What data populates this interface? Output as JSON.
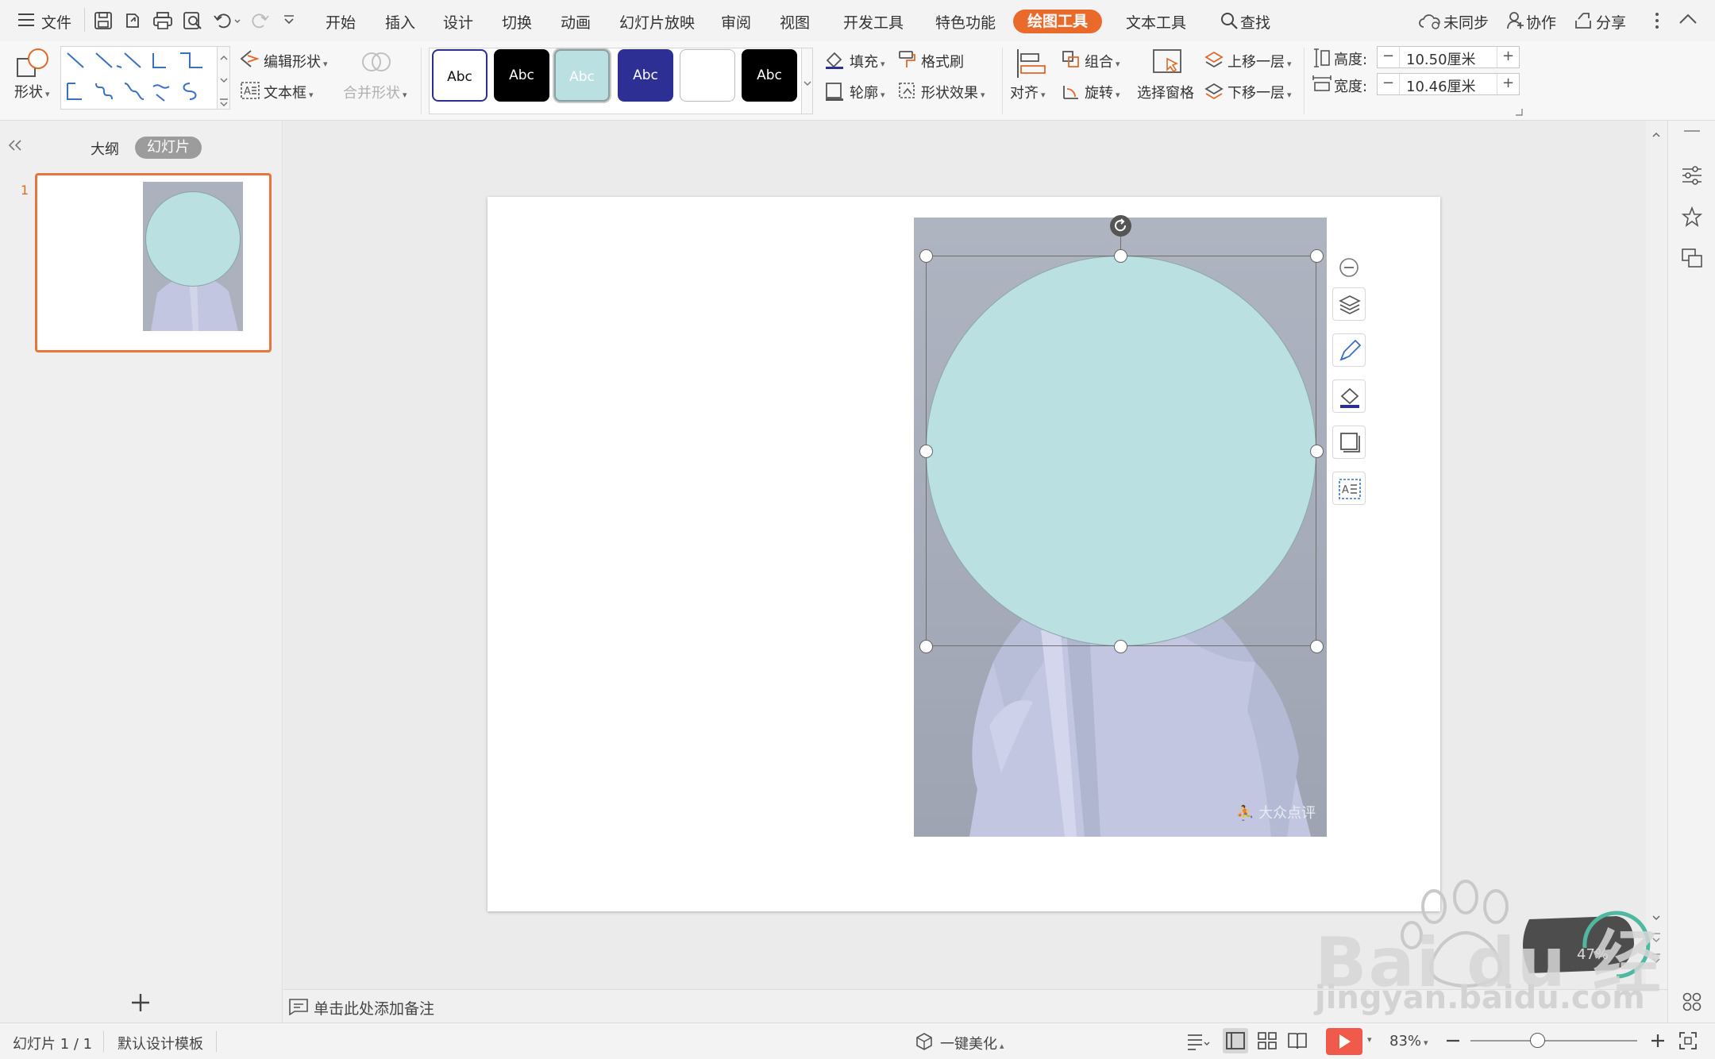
{
  "menu": {
    "file": "文件",
    "tabs": [
      "开始",
      "插入",
      "设计",
      "切换",
      "动画",
      "幻灯片放映",
      "审阅",
      "视图",
      "开发工具",
      "特色功能",
      "绘图工具",
      "文本工具"
    ],
    "search": "查找",
    "sync": "未同步",
    "collab": "协作",
    "share": "分享"
  },
  "ribbon": {
    "shape": "形状",
    "edit_shape": "编辑形状",
    "textbox": "文本框",
    "merge_shape": "合并形状",
    "style_label": "Abc",
    "fill": "填充",
    "format_painter": "格式刷",
    "outline": "轮廓",
    "shape_effect": "形状效果",
    "align": "对齐",
    "group": "组合",
    "rotate": "旋转",
    "selection_pane": "选择窗格",
    "bring_forward": "上移一层",
    "send_backward": "下移一层",
    "height_label": "高度:",
    "height_value": "10.50厘米",
    "width_label": "宽度:",
    "width_value": "10.46厘米"
  },
  "panel": {
    "outline_tab": "大纲",
    "slides_tab": "幻灯片",
    "slide_number": "1"
  },
  "notes": {
    "placeholder": "单击此处添加备注"
  },
  "photo": {
    "watermark": "大众点评"
  },
  "status": {
    "slide_info": "幻灯片 1 / 1",
    "template": "默认设计模板",
    "beautify": "一键美化",
    "zoom": "83%"
  },
  "colors": {
    "accent": "#ea6a2c",
    "circle_fill": "#bae0e2",
    "photo_bg": "#abb1bd",
    "blouse": "#c2c6e0",
    "style_dark_blue": "#2e2f94"
  },
  "overlay": {
    "brand": "Bai du 经验",
    "url": "jingyan.baidu.com"
  }
}
